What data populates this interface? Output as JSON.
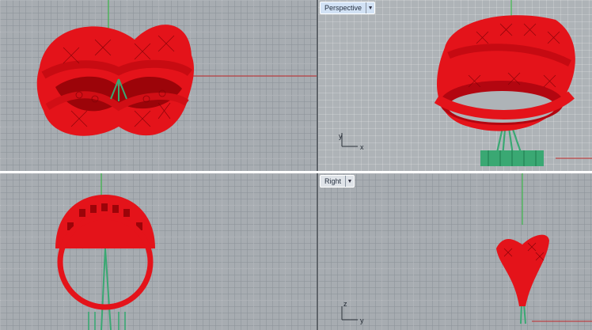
{
  "viewports": {
    "perspective": {
      "label": "Perspective",
      "active": true
    },
    "right": {
      "label": "Right"
    }
  },
  "axes": {
    "perspective": {
      "x": "x",
      "y": "y"
    },
    "right": {
      "z": "z",
      "y": "y"
    }
  },
  "icons": {
    "dropdown": "chevron-down-icon"
  },
  "colors": {
    "model": "#e4131a",
    "model_shade": "#8a0208",
    "support": "#3aa873",
    "axis_x": "#c0282a",
    "axis_y": "#3db84a",
    "viewport_bg": "#a7acb1"
  }
}
